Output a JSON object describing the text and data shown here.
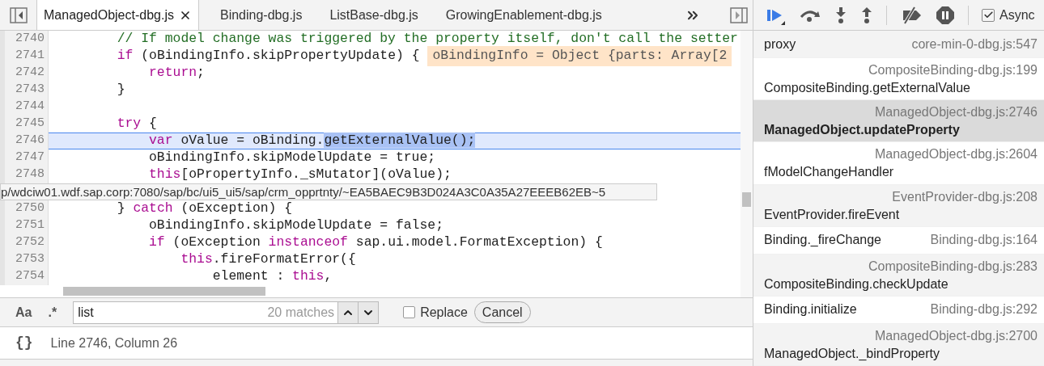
{
  "tabs": [
    {
      "label": "ManagedObject-dbg.js",
      "selected": true
    },
    {
      "label": "Binding-dbg.js",
      "selected": false
    },
    {
      "label": "ListBase-dbg.js",
      "selected": false
    },
    {
      "label": "GrowingEnablement-dbg.js",
      "selected": false
    }
  ],
  "code": {
    "lines": [
      {
        "number": "2740",
        "current": false,
        "tokens": [
          {
            "kind": "comment",
            "text": "        // If model change was triggered by the property itself, don't call the setter"
          }
        ]
      },
      {
        "number": "2741",
        "current": false,
        "tokens": [
          {
            "kind": "keyword",
            "text": "        if"
          },
          {
            "kind": "plain",
            "text": " (oBindingInfo.skipPropertyUpdate) {"
          }
        ],
        "inline_value": "oBindingInfo = Object {parts: Array[2"
      },
      {
        "number": "2742",
        "current": false,
        "tokens": [
          {
            "kind": "keyword",
            "text": "            return"
          },
          {
            "kind": "plain",
            "text": ";"
          }
        ]
      },
      {
        "number": "2743",
        "current": false,
        "tokens": [
          {
            "kind": "plain",
            "text": "        }"
          }
        ]
      },
      {
        "number": "2744",
        "current": false
      },
      {
        "number": "2745",
        "current": false,
        "tokens": [
          {
            "kind": "keyword",
            "text": "        try"
          },
          {
            "kind": "plain",
            "text": " {"
          }
        ]
      },
      {
        "number": "2746",
        "current": true,
        "tokens": [
          {
            "kind": "keyword",
            "text": "            var"
          },
          {
            "kind": "plain",
            "text": " oValue = oBinding."
          },
          {
            "kind": "match",
            "text": "getExternalValue();"
          }
        ]
      },
      {
        "number": "2747",
        "current": false,
        "tokens": [
          {
            "kind": "plain",
            "text": "            oBindingInfo.skipModelUpdate = true;"
          }
        ]
      },
      {
        "number": "2748",
        "current": false,
        "tokens": [
          {
            "kind": "keyword",
            "text": "            this"
          },
          {
            "kind": "plain",
            "text": "[oPropertyInfo._sMutator](oValue);"
          }
        ]
      },
      {
        "kind": "tooltip",
        "text": "p/wdciw01.wdf.sap.corp:7080/sap/bc/ui5_ui5/sap/crm_opprtnty/~EA5BAEC9B3D024A3C0A35A27EEEB62EB~5"
      },
      {
        "number": "2750",
        "current": false,
        "tokens": [
          {
            "kind": "plain",
            "text": "        } "
          },
          {
            "kind": "keyword",
            "text": "catch"
          },
          {
            "kind": "plain",
            "text": " (oException) {"
          }
        ]
      },
      {
        "number": "2751",
        "current": false,
        "tokens": [
          {
            "kind": "plain",
            "text": "            oBindingInfo.skipModelUpdate = false;"
          }
        ]
      },
      {
        "number": "2752",
        "current": false,
        "tokens": [
          {
            "kind": "keyword",
            "text": "            if"
          },
          {
            "kind": "plain",
            "text": " (oException "
          },
          {
            "kind": "keyword",
            "text": "instanceof"
          },
          {
            "kind": "plain",
            "text": " sap.ui.model.FormatException) {"
          }
        ]
      },
      {
        "number": "2753",
        "current": false,
        "tokens": [
          {
            "kind": "keyword",
            "text": "                this"
          },
          {
            "kind": "plain",
            "text": ".fireFormatError({"
          }
        ]
      },
      {
        "number": "2754",
        "current": false,
        "tokens": [
          {
            "kind": "plain",
            "text": "                    element : "
          },
          {
            "kind": "keyword",
            "text": "this"
          },
          {
            "kind": "plain",
            "text": ","
          }
        ]
      }
    ]
  },
  "search": {
    "case_toggle": "Aa",
    "regex_toggle": ".*",
    "value": "list",
    "matches": "20 matches",
    "replace": {
      "label": "Replace",
      "checked": false
    },
    "cancel": "Cancel"
  },
  "status_bar": {
    "pretty_print": "{}",
    "position": "Line 2746, Column 26"
  },
  "debugger": {
    "async": {
      "label": "Async",
      "checked": true
    },
    "call_stack": [
      {
        "kind": "inline",
        "function": "proxy",
        "location": "core-min-0-dbg.js:547",
        "selected": false
      },
      {
        "kind": "stacked",
        "function": "CompositeBinding.getExternalValue",
        "location": "CompositeBinding-dbg.js:199",
        "selected": false
      },
      {
        "kind": "stacked",
        "function": "ManagedObject.updateProperty",
        "location": "ManagedObject-dbg.js:2746",
        "selected": true
      },
      {
        "kind": "stacked",
        "function": "fModelChangeHandler",
        "location": "ManagedObject-dbg.js:2604",
        "selected": false
      },
      {
        "kind": "stacked",
        "function": "EventProvider.fireEvent",
        "location": "EventProvider-dbg.js:208",
        "selected": false
      },
      {
        "kind": "inline",
        "function": "Binding._fireChange",
        "location": "Binding-dbg.js:164",
        "selected": false
      },
      {
        "kind": "stacked",
        "function": "CompositeBinding.checkUpdate",
        "location": "CompositeBinding-dbg.js:283",
        "selected": false
      },
      {
        "kind": "inline",
        "function": "Binding.initialize",
        "location": "Binding-dbg.js:292",
        "selected": false
      },
      {
        "kind": "stacked",
        "function": "ManagedObject._bindProperty",
        "location": "ManagedObject-dbg.js:2700",
        "selected": false
      }
    ]
  }
}
